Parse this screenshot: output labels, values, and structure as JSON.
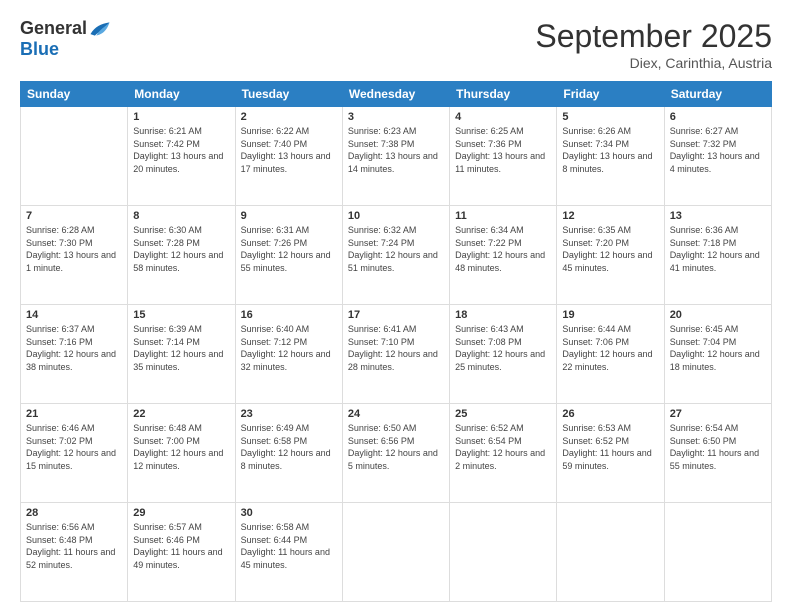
{
  "logo": {
    "general": "General",
    "blue": "Blue"
  },
  "header": {
    "month": "September 2025",
    "location": "Diex, Carinthia, Austria"
  },
  "weekdays": [
    "Sunday",
    "Monday",
    "Tuesday",
    "Wednesday",
    "Thursday",
    "Friday",
    "Saturday"
  ],
  "weeks": [
    [
      {
        "day": "",
        "sunrise": "",
        "sunset": "",
        "daylight": ""
      },
      {
        "day": "1",
        "sunrise": "Sunrise: 6:21 AM",
        "sunset": "Sunset: 7:42 PM",
        "daylight": "Daylight: 13 hours and 20 minutes."
      },
      {
        "day": "2",
        "sunrise": "Sunrise: 6:22 AM",
        "sunset": "Sunset: 7:40 PM",
        "daylight": "Daylight: 13 hours and 17 minutes."
      },
      {
        "day": "3",
        "sunrise": "Sunrise: 6:23 AM",
        "sunset": "Sunset: 7:38 PM",
        "daylight": "Daylight: 13 hours and 14 minutes."
      },
      {
        "day": "4",
        "sunrise": "Sunrise: 6:25 AM",
        "sunset": "Sunset: 7:36 PM",
        "daylight": "Daylight: 13 hours and 11 minutes."
      },
      {
        "day": "5",
        "sunrise": "Sunrise: 6:26 AM",
        "sunset": "Sunset: 7:34 PM",
        "daylight": "Daylight: 13 hours and 8 minutes."
      },
      {
        "day": "6",
        "sunrise": "Sunrise: 6:27 AM",
        "sunset": "Sunset: 7:32 PM",
        "daylight": "Daylight: 13 hours and 4 minutes."
      }
    ],
    [
      {
        "day": "7",
        "sunrise": "Sunrise: 6:28 AM",
        "sunset": "Sunset: 7:30 PM",
        "daylight": "Daylight: 13 hours and 1 minute."
      },
      {
        "day": "8",
        "sunrise": "Sunrise: 6:30 AM",
        "sunset": "Sunset: 7:28 PM",
        "daylight": "Daylight: 12 hours and 58 minutes."
      },
      {
        "day": "9",
        "sunrise": "Sunrise: 6:31 AM",
        "sunset": "Sunset: 7:26 PM",
        "daylight": "Daylight: 12 hours and 55 minutes."
      },
      {
        "day": "10",
        "sunrise": "Sunrise: 6:32 AM",
        "sunset": "Sunset: 7:24 PM",
        "daylight": "Daylight: 12 hours and 51 minutes."
      },
      {
        "day": "11",
        "sunrise": "Sunrise: 6:34 AM",
        "sunset": "Sunset: 7:22 PM",
        "daylight": "Daylight: 12 hours and 48 minutes."
      },
      {
        "day": "12",
        "sunrise": "Sunrise: 6:35 AM",
        "sunset": "Sunset: 7:20 PM",
        "daylight": "Daylight: 12 hours and 45 minutes."
      },
      {
        "day": "13",
        "sunrise": "Sunrise: 6:36 AM",
        "sunset": "Sunset: 7:18 PM",
        "daylight": "Daylight: 12 hours and 41 minutes."
      }
    ],
    [
      {
        "day": "14",
        "sunrise": "Sunrise: 6:37 AM",
        "sunset": "Sunset: 7:16 PM",
        "daylight": "Daylight: 12 hours and 38 minutes."
      },
      {
        "day": "15",
        "sunrise": "Sunrise: 6:39 AM",
        "sunset": "Sunset: 7:14 PM",
        "daylight": "Daylight: 12 hours and 35 minutes."
      },
      {
        "day": "16",
        "sunrise": "Sunrise: 6:40 AM",
        "sunset": "Sunset: 7:12 PM",
        "daylight": "Daylight: 12 hours and 32 minutes."
      },
      {
        "day": "17",
        "sunrise": "Sunrise: 6:41 AM",
        "sunset": "Sunset: 7:10 PM",
        "daylight": "Daylight: 12 hours and 28 minutes."
      },
      {
        "day": "18",
        "sunrise": "Sunrise: 6:43 AM",
        "sunset": "Sunset: 7:08 PM",
        "daylight": "Daylight: 12 hours and 25 minutes."
      },
      {
        "day": "19",
        "sunrise": "Sunrise: 6:44 AM",
        "sunset": "Sunset: 7:06 PM",
        "daylight": "Daylight: 12 hours and 22 minutes."
      },
      {
        "day": "20",
        "sunrise": "Sunrise: 6:45 AM",
        "sunset": "Sunset: 7:04 PM",
        "daylight": "Daylight: 12 hours and 18 minutes."
      }
    ],
    [
      {
        "day": "21",
        "sunrise": "Sunrise: 6:46 AM",
        "sunset": "Sunset: 7:02 PM",
        "daylight": "Daylight: 12 hours and 15 minutes."
      },
      {
        "day": "22",
        "sunrise": "Sunrise: 6:48 AM",
        "sunset": "Sunset: 7:00 PM",
        "daylight": "Daylight: 12 hours and 12 minutes."
      },
      {
        "day": "23",
        "sunrise": "Sunrise: 6:49 AM",
        "sunset": "Sunset: 6:58 PM",
        "daylight": "Daylight: 12 hours and 8 minutes."
      },
      {
        "day": "24",
        "sunrise": "Sunrise: 6:50 AM",
        "sunset": "Sunset: 6:56 PM",
        "daylight": "Daylight: 12 hours and 5 minutes."
      },
      {
        "day": "25",
        "sunrise": "Sunrise: 6:52 AM",
        "sunset": "Sunset: 6:54 PM",
        "daylight": "Daylight: 12 hours and 2 minutes."
      },
      {
        "day": "26",
        "sunrise": "Sunrise: 6:53 AM",
        "sunset": "Sunset: 6:52 PM",
        "daylight": "Daylight: 11 hours and 59 minutes."
      },
      {
        "day": "27",
        "sunrise": "Sunrise: 6:54 AM",
        "sunset": "Sunset: 6:50 PM",
        "daylight": "Daylight: 11 hours and 55 minutes."
      }
    ],
    [
      {
        "day": "28",
        "sunrise": "Sunrise: 6:56 AM",
        "sunset": "Sunset: 6:48 PM",
        "daylight": "Daylight: 11 hours and 52 minutes."
      },
      {
        "day": "29",
        "sunrise": "Sunrise: 6:57 AM",
        "sunset": "Sunset: 6:46 PM",
        "daylight": "Daylight: 11 hours and 49 minutes."
      },
      {
        "day": "30",
        "sunrise": "Sunrise: 6:58 AM",
        "sunset": "Sunset: 6:44 PM",
        "daylight": "Daylight: 11 hours and 45 minutes."
      },
      {
        "day": "",
        "sunrise": "",
        "sunset": "",
        "daylight": ""
      },
      {
        "day": "",
        "sunrise": "",
        "sunset": "",
        "daylight": ""
      },
      {
        "day": "",
        "sunrise": "",
        "sunset": "",
        "daylight": ""
      },
      {
        "day": "",
        "sunrise": "",
        "sunset": "",
        "daylight": ""
      }
    ]
  ]
}
